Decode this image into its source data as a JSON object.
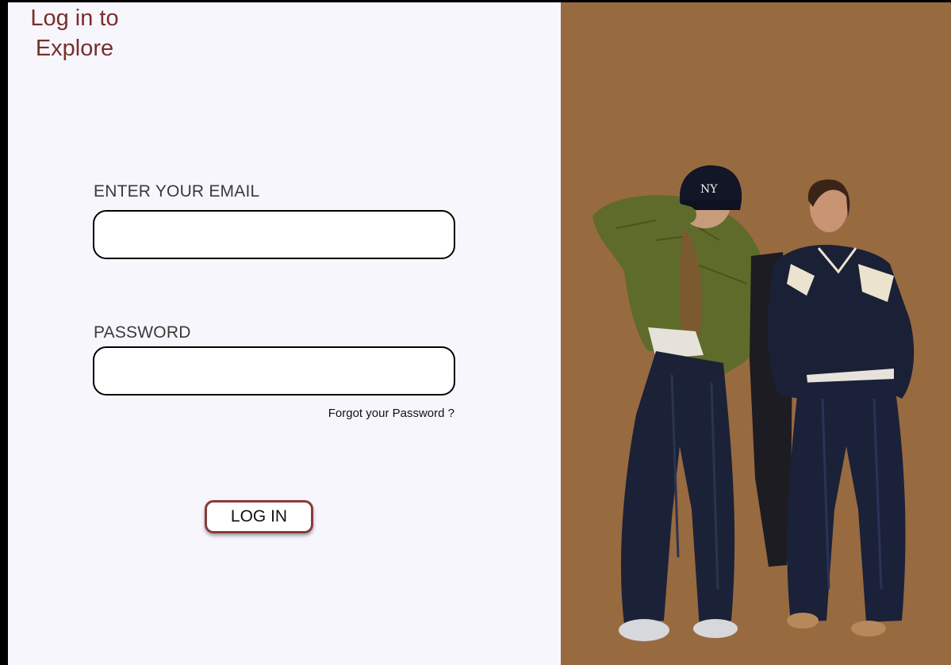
{
  "page": {
    "title": "Log in to Explore"
  },
  "form": {
    "email_label": "ENTER YOUR EMAIL",
    "email_value": "",
    "email_placeholder": "",
    "password_label": "PASSWORD",
    "password_value": "",
    "password_placeholder": "",
    "forgot_link": "Forgot your Password ?",
    "login_label": "LOG IN"
  },
  "colors": {
    "panel_bg": "#f7f6fd",
    "photo_bg": "#986a40",
    "title_color": "#7a2e2e",
    "button_border": "#8a3a3a"
  },
  "image": {
    "icon": "fashion-models-photo"
  }
}
